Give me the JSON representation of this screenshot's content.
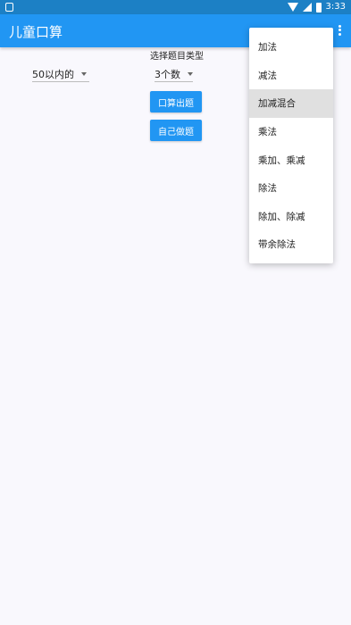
{
  "status_bar": {
    "time": "3:33",
    "icons": [
      "notification-icon",
      "wifi-icon",
      "cellular-icon",
      "battery-icon"
    ]
  },
  "app_bar": {
    "title": "儿童口算",
    "background": "#2196f3",
    "overflow_icon": "more-vert-icon"
  },
  "controls": {
    "range_value": "50以内的",
    "type_label": "选择题目类型",
    "count_value": "3个数",
    "generate_button": "口算出题",
    "self_button": "自己做题"
  },
  "menu": {
    "items": [
      {
        "label": "加法"
      },
      {
        "label": "减法"
      },
      {
        "label": "加减混合"
      },
      {
        "label": "乘法"
      },
      {
        "label": "乘加、乘减"
      },
      {
        "label": "除法"
      },
      {
        "label": "除加、除减"
      },
      {
        "label": "带余除法"
      }
    ],
    "selected_item": "加减混合"
  }
}
